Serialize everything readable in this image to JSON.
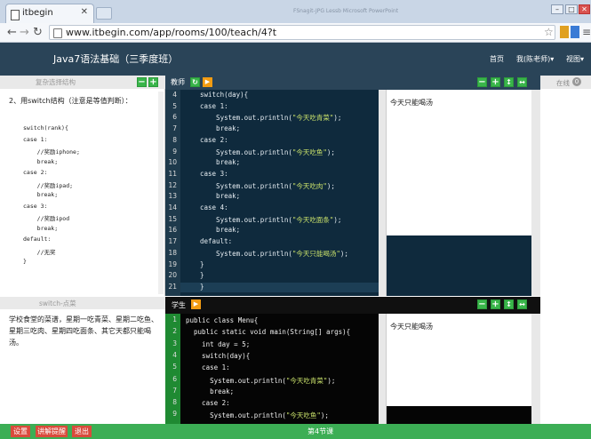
{
  "browser": {
    "tab_title": "itbegin",
    "window_title": "FSnagit-JPG Lessb   Microsoft PowerPoint",
    "url": "www.itbegin.com/app/rooms/100/teach/4?t",
    "back_icon": "back-arrow-icon",
    "forward_icon": "forward-arrow-icon",
    "reload_icon": "reload-icon",
    "star_icon": "star-icon",
    "menu_icon": "menu-icon"
  },
  "app": {
    "title": "Java7语法基础（三季度班）",
    "nav_home": "首页",
    "nav_user": "我(陈老师)▾",
    "nav_view": "视图▾",
    "accent": "#39b54a",
    "header_color": "#2a4458"
  },
  "left_top": {
    "header": "复杂选择结构",
    "add1": "−",
    "add2": "+",
    "question": "2、用switch结构（注意是等值判断）：",
    "code": [
      "switch(rank){",
      "case 1:",
      "    //奖励iphone;",
      "    break;",
      "case 2:",
      "    //奖励ipad;",
      "    break;",
      "case 3:",
      "    //奖励ipod",
      "    break;",
      "default:",
      "    //无奖",
      "}"
    ]
  },
  "left_bottom": {
    "header": "switch-点菜",
    "text": "学校食堂的菜谱，星期一吃青菜、星期二吃鱼、星期三吃肉、星期四吃面条、其它天都只能喝汤。"
  },
  "teacher": {
    "label": "教师",
    "refresh_icon": "refresh-icon",
    "run_icon": "play-icon",
    "line_numbers": [
      "4",
      "5",
      "6",
      "7",
      "8",
      "9",
      "10",
      "11",
      "12",
      "13",
      "14",
      "15",
      "16",
      "17",
      "18",
      "19",
      "20",
      "21"
    ],
    "code": [
      "switch(day){",
      "case 1:",
      "    System.out.println(\"今天吃青菜\");",
      "    break;",
      "case 2:",
      "    System.out.println(\"今天吃鱼\");",
      "    break;",
      "case 3:",
      "    System.out.println(\"今天吃肉\");",
      "    break;",
      "case 4:",
      "    System.out.println(\"今天吃面条\");",
      "    break;",
      "default:",
      "    System.out.println(\"今天只能喝汤\");",
      "}",
      "}",
      "}"
    ],
    "output": "今天只能喝汤"
  },
  "student": {
    "label": "学生",
    "run_icon": "play-icon",
    "line_numbers": [
      "1",
      "2",
      "3",
      "4",
      "5",
      "6",
      "7",
      "8",
      "9"
    ],
    "code": [
      "public class Menu{",
      "  public static void main(String[] args){",
      "    int day = 5;",
      "    switch(day){",
      "    case 1:",
      "      System.out.println(\"今天吃青菜\");",
      "      break;",
      "    case 2:",
      "      System.out.println(\"今天吃鱼\");"
    ],
    "output": "今天只能喝汤"
  },
  "online": {
    "label": "在线",
    "count": "0"
  },
  "footer": {
    "btn_settings": "设置",
    "btn_explain": "讲解提醒",
    "btn_exit": "退出",
    "section": "第4节课"
  }
}
